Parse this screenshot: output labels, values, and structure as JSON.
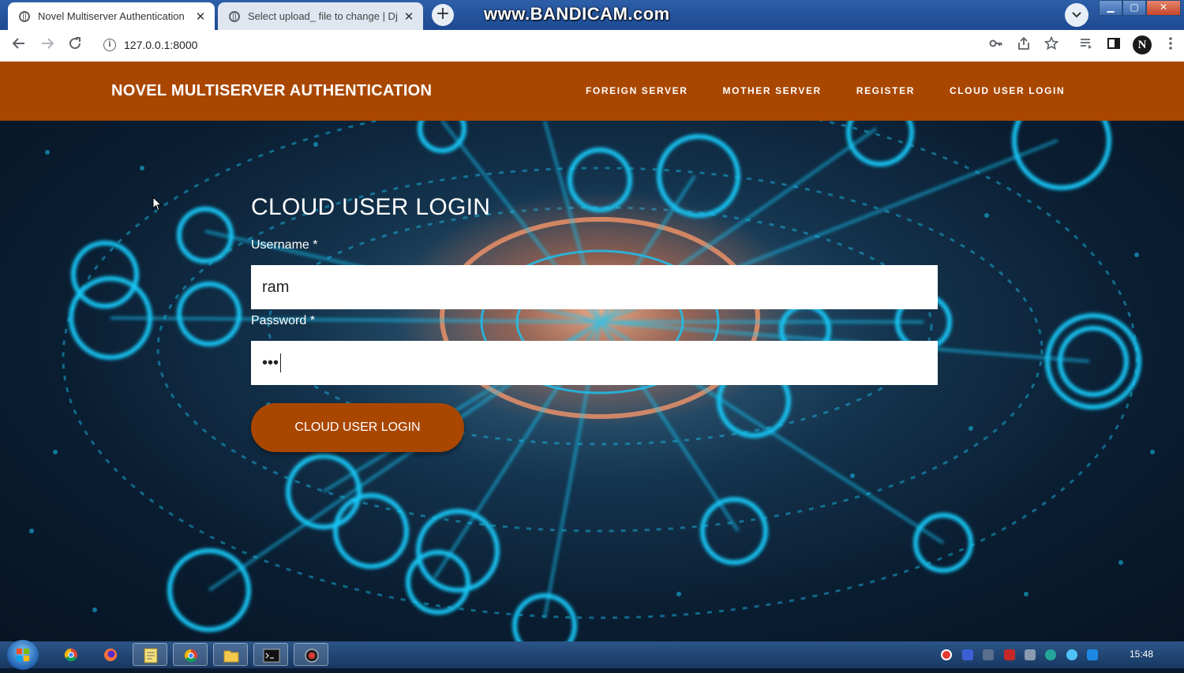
{
  "browser": {
    "tabs": [
      {
        "title": "Novel Multiserver Authentication",
        "close": "✕"
      },
      {
        "title": "Select upload_ file to change | Dj",
        "close": "✕"
      }
    ],
    "new_tab": "+",
    "watermark": "www.BANDICAM.com",
    "url": "127.0.0.1:8000",
    "profile_initial": "N"
  },
  "site": {
    "brand": "NOVEL MULTISERVER AUTHENTICATION",
    "nav": [
      "FOREIGN SERVER",
      "MOTHER SERVER",
      "REGISTER",
      "CLOUD USER LOGIN"
    ]
  },
  "form": {
    "title": "CLOUD USER LOGIN",
    "username_label": "Username *",
    "username_value": "ram",
    "password_label": "Password *",
    "password_mask": "•••",
    "submit_label": "CLOUD USER LOGIN"
  },
  "taskbar": {
    "clock": "15:48"
  },
  "colors": {
    "brand_orange": "#a94700",
    "glow_cyan": "#19c6f5"
  }
}
